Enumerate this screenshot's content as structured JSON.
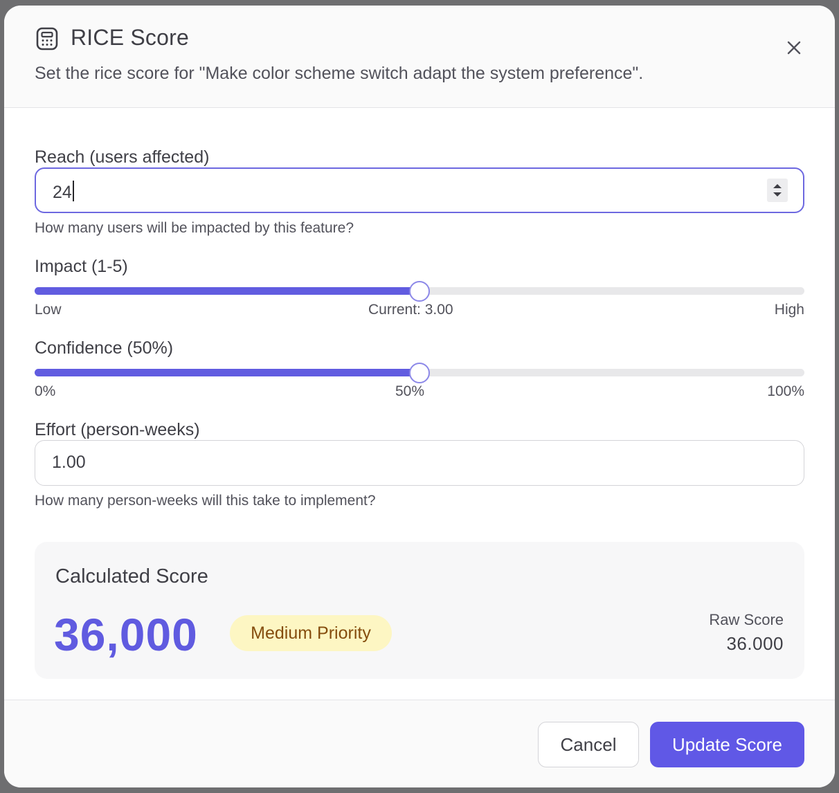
{
  "dialog": {
    "title": "RICE Score",
    "subtitle": "Set the rice score for \"Make color scheme switch adapt the system preference\".",
    "title_icon": "calculator-icon",
    "close_icon": "close-icon"
  },
  "reach": {
    "label": "Reach (users affected)",
    "value": "24",
    "help": "How many users will be impacted by this feature?"
  },
  "impact": {
    "label": "Impact (1-5)",
    "min": 1,
    "max": 5,
    "value": 3,
    "low_label": "Low",
    "current_label": "Current: 3.00",
    "high_label": "High"
  },
  "confidence": {
    "label": "Confidence (50%)",
    "min": 0,
    "max": 100,
    "value": 50,
    "min_label": "0%",
    "mid_label": "50%",
    "max_label": "100%"
  },
  "effort": {
    "label": "Effort (person-weeks)",
    "value": "1.00",
    "help": "How many person-weeks will this take to implement?"
  },
  "score": {
    "title": "Calculated Score",
    "value": "36,000",
    "priority": "Medium Priority",
    "raw_label": "Raw Score",
    "raw_value": "36.000"
  },
  "footer": {
    "cancel_label": "Cancel",
    "update_label": "Update Score"
  },
  "colors": {
    "accent": "#605be0",
    "badge_bg": "#fdf6c3",
    "badge_text": "#854d0e"
  }
}
